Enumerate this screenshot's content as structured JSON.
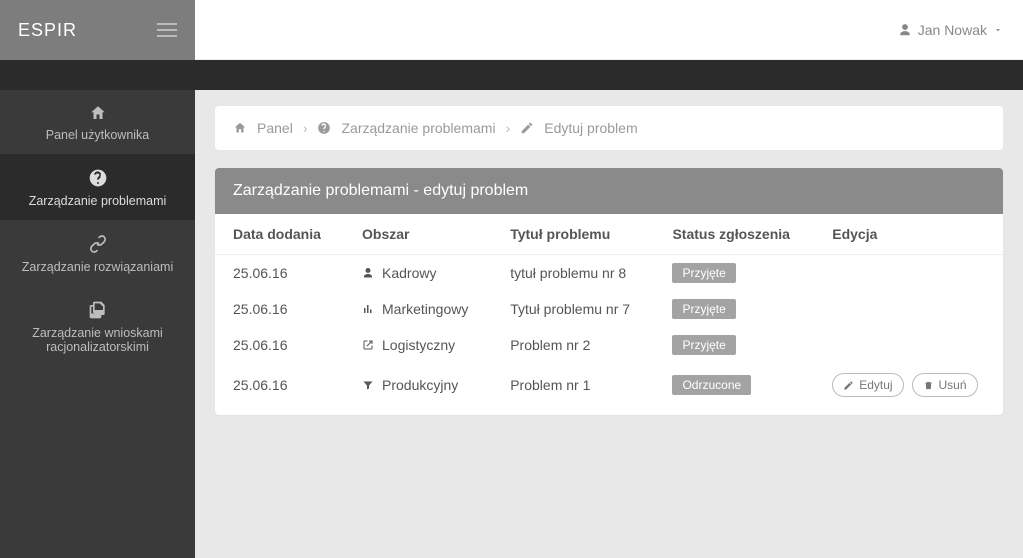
{
  "brand": "ESPIR",
  "user_name": "Jan Nowak",
  "nav": {
    "items": [
      {
        "label": "Panel użytkownika"
      },
      {
        "label": "Zarządzanie problemami"
      },
      {
        "label": "Zarządzanie rozwiązaniami"
      },
      {
        "label": "Zarządzanie wnioskami racjonalizatorskimi"
      }
    ]
  },
  "breadcrumbs": {
    "first": "Panel",
    "second": "Zarządzanie problemami",
    "third": "Edytuj problem"
  },
  "panel_title": "Zarządzanie problemami - edytuj problem",
  "columns": {
    "date": "Data dodania",
    "area": "Obszar",
    "title": "Tytuł problemu",
    "status": "Status zgłoszenia",
    "edit": "Edycja"
  },
  "rows": [
    {
      "date": "25.06.16",
      "area": "Kadrowy",
      "title": "tytuł problemu nr 8",
      "status": "Przyjęte"
    },
    {
      "date": "25.06.16",
      "area": "Marketingowy",
      "title": "Tytuł problemu nr 7",
      "status": "Przyjęte"
    },
    {
      "date": "25.06.16",
      "area": "Logistyczny",
      "title": "Problem nr 2",
      "status": "Przyjęte"
    },
    {
      "date": "25.06.16",
      "area": "Produkcyjny",
      "title": "Problem nr 1",
      "status": "Odrzucone"
    }
  ],
  "actions": {
    "edit": "Edytuj",
    "delete": "Usuń"
  }
}
